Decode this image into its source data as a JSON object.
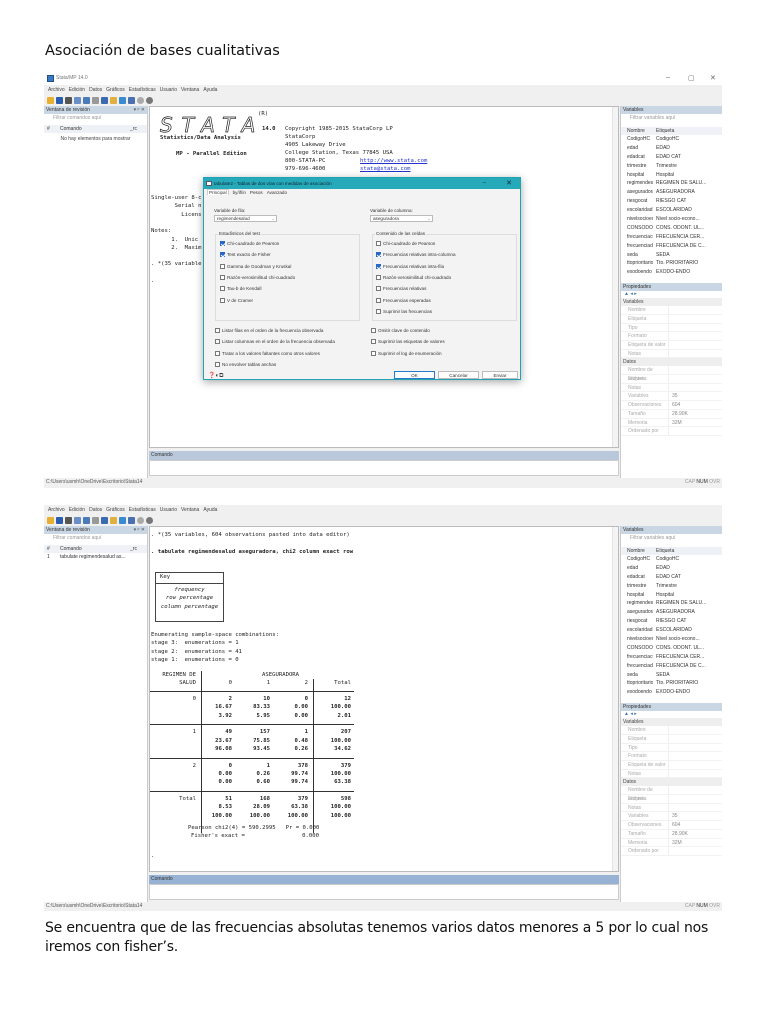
{
  "doc": {
    "heading": "Asociación de bases cualitativas",
    "paragraph": "Se encuentra que de las frecuencias absolutas tenemos varios datos menores a 5 por lo cual nos iremos con fisher’s."
  },
  "app": {
    "title": "Stata/MP 14.0",
    "window_controls": [
      "–",
      "▢",
      "✕"
    ],
    "menu": [
      "Archivo",
      "Edición",
      "Datos",
      "Gráficos",
      "Estadísticas",
      "Usuario",
      "Ventana",
      "Ayuda"
    ],
    "review": {
      "title": "Ventana de revisión",
      "pin": "▾ ᵖ ✕",
      "filter_placeholder": "Filtrar comandos aquí",
      "col_num": "#",
      "col_cmd": "Comando",
      "col_rc": "_rc",
      "empty": "No hay elementos para mostrar"
    },
    "variables": {
      "title": "Variables",
      "filter_placeholder": "Filtrar variables aquí",
      "col_name": "Nombre",
      "col_label": "Etiqueta",
      "rows": [
        [
          "CodigoHC",
          "CodigoHC"
        ],
        [
          "edad",
          "EDAD"
        ],
        [
          "edadcat",
          "EDAD CAT"
        ],
        [
          "trimestre",
          "Trimestre"
        ],
        [
          "hospital",
          "Hospital"
        ],
        [
          "regimendesal...",
          "REGIMEN DE SALU..."
        ],
        [
          "aseguradora",
          "ASEGURADORA"
        ],
        [
          "riesgocat",
          "RIESGO CAT"
        ],
        [
          "escolaridad",
          "ESCOLARIDAD"
        ],
        [
          "nivelsocioeco...",
          "Nivel socio-econo..."
        ],
        [
          "CONSODONT...",
          "CONS. ODONT. UL..."
        ],
        [
          "frecuenciacep...",
          "FRECUENCIA CER..."
        ],
        [
          "frecuenciadec...",
          "FRECUENCIA DE C..."
        ],
        [
          "seda",
          "SEDA"
        ],
        [
          "ttoprioritario",
          "Tto. PRIORITARIO"
        ],
        [
          "exodoendo",
          "EXODO-ENDO"
        ]
      ]
    },
    "properties": {
      "title": "Propiedades",
      "section_variables": "Variables",
      "variable_fields": [
        "Nombre",
        "Etiqueta",
        "Tipo",
        "Formato",
        "Etiqueta de valor",
        "Notas"
      ],
      "section_data": "Datos",
      "data_fields": [
        [
          "Nombre de archivo",
          ""
        ],
        [
          "Etiqueta",
          ""
        ],
        [
          "Notas",
          ""
        ],
        [
          "Variables",
          "35"
        ],
        [
          "Observaciones",
          "604"
        ],
        [
          "Tamaño",
          "28.90K"
        ],
        [
          "Memoria",
          "32M"
        ],
        [
          "Ordenado por",
          ""
        ]
      ]
    },
    "command_label": "Comando",
    "status_path": "C:\\Users\\usmh\\OneDrive\\Escritorio\\Stata14",
    "status_flags": [
      "CAP",
      "NUM",
      "OVR"
    ]
  },
  "screen1": {
    "results": {
      "registered": "(R)",
      "logo": "STATA",
      "version": "14.0",
      "copyright": "Copyright 1985-2015 StataCorp LP",
      "company": "StataCorp",
      "address": "4905 Lakeway Drive",
      "city": "College Station, Texas 77845 USA",
      "phone": "800-STATA-PC",
      "url": "http://www.stata.com",
      "phone2": "979-696-4600",
      "email": "stata@stata.com",
      "product": "Statistics/Data Analysis",
      "edition": "MP - Parallel Edition",
      "lines": [
        "Single-user 8-c",
        "       Serial n",
        "         Licens",
        "",
        "Notes:",
        "      1.  Unic",
        "      2.  Maxim",
        "",
        ". *(35 variable",
        "",
        "."
      ]
    },
    "dialog": {
      "title": "tabulate2 - Tablas de dos vías con medidas de asociación",
      "tabs": [
        "Principal",
        "by/if/in",
        "Pesos",
        "Avanzado"
      ],
      "row_var_label": "Variable de fila:",
      "row_var_value": "regimendesalud",
      "col_var_label": "Variable de columna:",
      "col_var_value": "aseguradora",
      "test_group": "Estadísticos del test",
      "tests": [
        {
          "label": "Chi-cuadrado de Pearson",
          "checked": true
        },
        {
          "label": "Test exacto de Fisher",
          "checked": true
        },
        {
          "label": "Gamma de Goodman y Kruskal",
          "checked": false
        },
        {
          "label": "Razón-verosimilitud chi-cuadrado",
          "checked": false
        },
        {
          "label": "Tau-b de Kendall",
          "checked": false
        },
        {
          "label": "V de Cramer",
          "checked": false
        }
      ],
      "cell_group": "Contenido de las celdas",
      "cells": [
        {
          "label": "Chi-cuadrado de Pearson",
          "checked": false
        },
        {
          "label": "Frecuencias relativas intra-columna",
          "checked": true
        },
        {
          "label": "Frecuencias relativas intra-fila",
          "checked": true
        },
        {
          "label": "Razón-verosimilitud chi-cuadrado",
          "checked": false
        },
        {
          "label": "Frecuencias relativas",
          "checked": false
        },
        {
          "label": "Frecuencias esperadas",
          "checked": false
        },
        {
          "label": "Suprimir las frecuencias",
          "checked": false
        }
      ],
      "options_left": [
        {
          "label": "Listar filas en el orden de la frecuencia observada",
          "checked": false
        },
        {
          "label": "Listar columnas en el orden de la frecuencia observada",
          "checked": false
        },
        {
          "label": "Tratar a los valores faltantes como otros valores",
          "checked": false
        },
        {
          "label": "No envolver tablas anchas",
          "checked": false
        }
      ],
      "options_right": [
        {
          "label": "Omitir clave de contenido",
          "checked": false
        },
        {
          "label": "Suprimir las etiquetas de valores",
          "checked": false
        },
        {
          "label": "Suprimir el log de enumeración",
          "checked": false
        }
      ],
      "buttons": {
        "ok": "OK",
        "cancel": "Cancelar",
        "submit": "Enviar"
      }
    }
  },
  "screen2": {
    "review_item": {
      "num": "1",
      "cmd": "tabulate regimendesalud as..."
    },
    "results": {
      "line1": ". *(35 variables, 604 observations pasted into data editor)",
      "command": ". tabulate regimendesalud aseguradora, chi2 column exact row",
      "key_title": "Key",
      "key_items": [
        "frequency",
        "row percentage",
        "column percentage"
      ],
      "enum_lines": [
        "Enumerating sample-space combinations:",
        "stage 3:  enumerations = 1",
        "stage 2:  enumerations = 41",
        "stage 1:  enumerations = 0"
      ],
      "table": {
        "row_var": [
          "REGIMEN DE",
          "SALUD"
        ],
        "col_var": "ASEGURADORA",
        "columns": [
          "0",
          "1",
          "2",
          "Total"
        ],
        "rows": [
          {
            "label": "0",
            "freq": [
              "2",
              "10",
              "0",
              "12"
            ],
            "row_pct": [
              "16.67",
              "83.33",
              "0.00",
              "100.00"
            ],
            "col_pct": [
              "3.92",
              "5.95",
              "0.00",
              "2.01"
            ]
          },
          {
            "label": "1",
            "freq": [
              "49",
              "157",
              "1",
              "207"
            ],
            "row_pct": [
              "23.67",
              "75.85",
              "0.48",
              "100.00"
            ],
            "col_pct": [
              "96.08",
              "93.45",
              "0.26",
              "34.62"
            ]
          },
          {
            "label": "2",
            "freq": [
              "0",
              "1",
              "378",
              "379"
            ],
            "row_pct": [
              "0.00",
              "0.26",
              "99.74",
              "100.00"
            ],
            "col_pct": [
              "0.00",
              "0.60",
              "99.74",
              "63.38"
            ]
          },
          {
            "label": "Total",
            "freq": [
              "51",
              "168",
              "379",
              "598"
            ],
            "row_pct": [
              "8.53",
              "28.09",
              "63.38",
              "100.00"
            ],
            "col_pct": [
              "100.00",
              "100.00",
              "100.00",
              "100.00"
            ]
          }
        ]
      },
      "pearson": "Pearson chi2(4) = 590.2995   Pr = 0.000",
      "fisher": "Fisher's exact =                 0.000",
      "prompt": "."
    }
  }
}
